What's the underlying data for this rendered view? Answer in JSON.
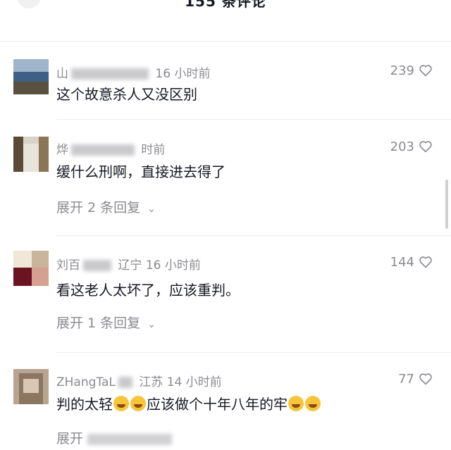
{
  "header": {
    "title": "155 条评论"
  },
  "comments": [
    {
      "user": "山",
      "time": "16 小时前",
      "text": "这个故意杀人又没区别",
      "likes": "239"
    },
    {
      "user": "烨",
      "time": "时前",
      "text": "缓什么刑啊，直接进去得了",
      "likes": "203",
      "expand": "展开 2 条回复"
    },
    {
      "user": "刘百",
      "location": "辽宁",
      "time": "16 小时前",
      "text": "看这老人太坏了，应该重判。",
      "likes": "144",
      "expand": "展开 1 条回复"
    },
    {
      "user": "ZHangTaL",
      "location": "江苏",
      "time": "14 小时前",
      "text_a": "判的太轻",
      "text_b": "应该做个十年八年的牢",
      "likes": "77",
      "expand": "展开"
    }
  ],
  "icons": {
    "like": "heart-outline-icon",
    "expand": "chevron-down-icon"
  },
  "colors": {
    "primary_text": "#161823",
    "secondary_text": "#8a8b91",
    "emoji": "#f6c53a"
  }
}
